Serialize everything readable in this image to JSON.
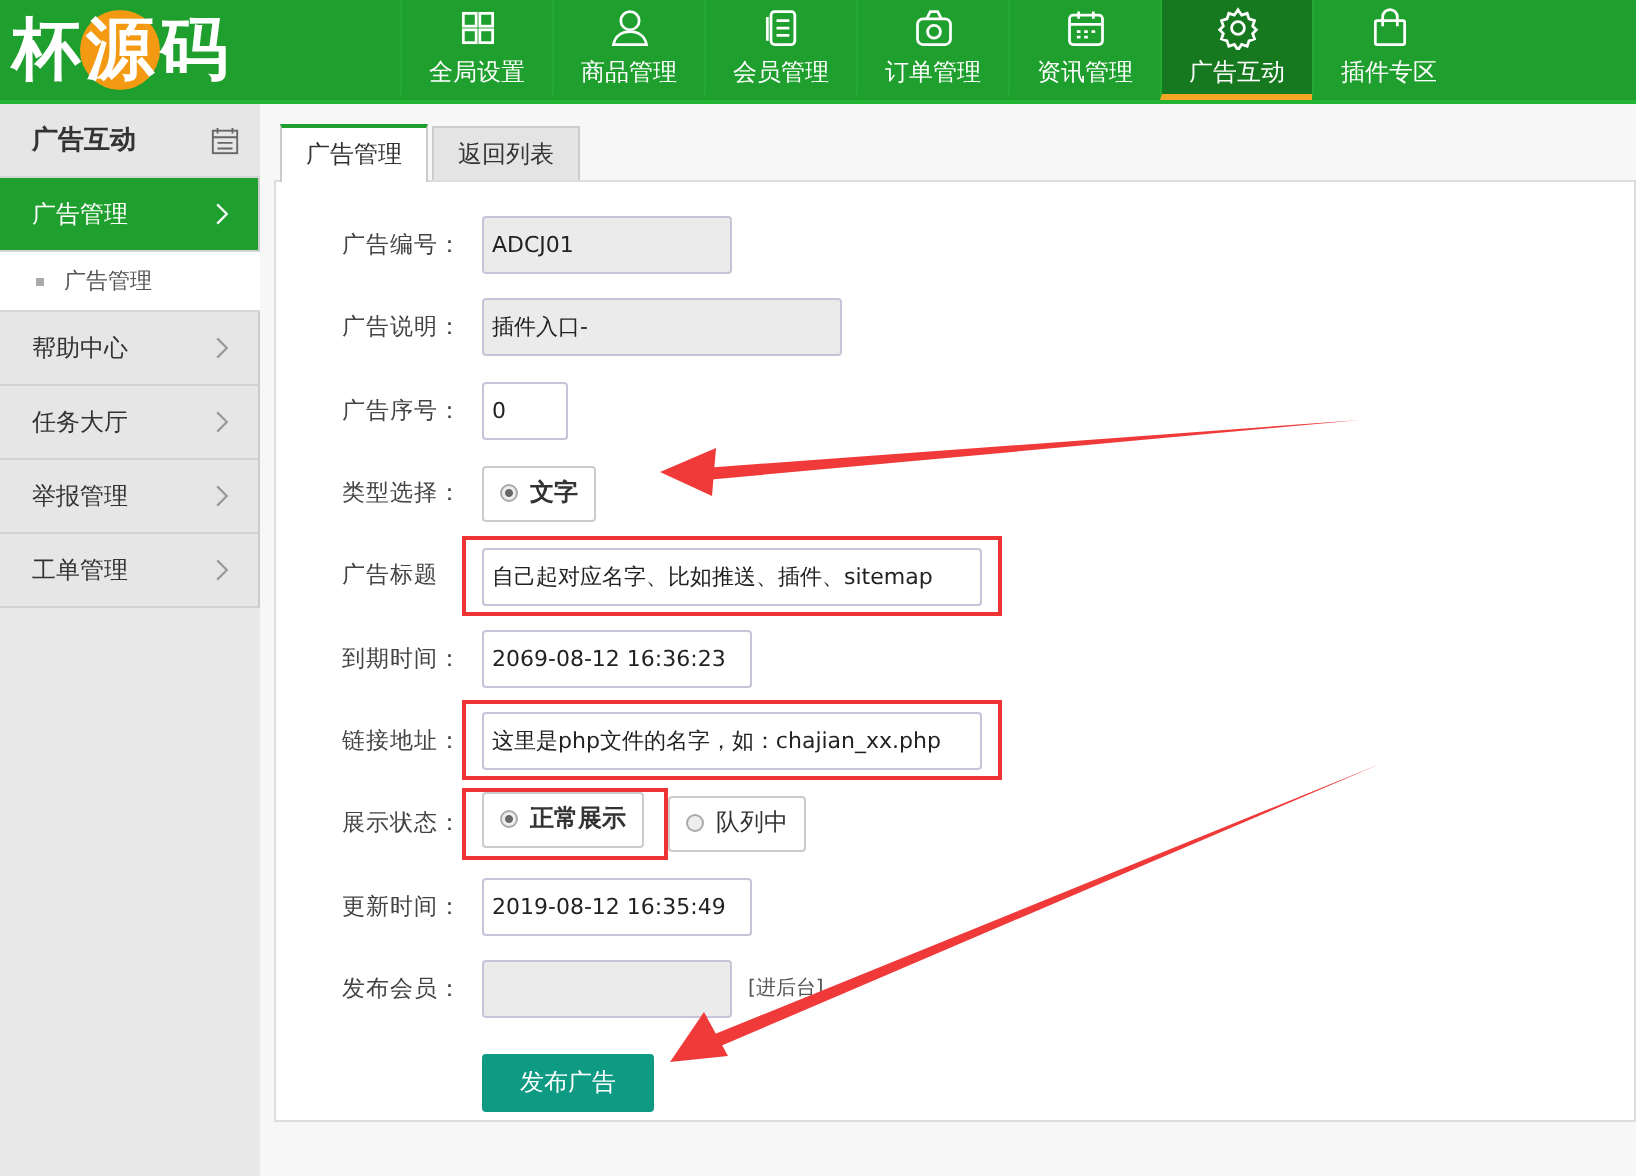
{
  "logo": {
    "parts": [
      "杯",
      "源",
      "码"
    ]
  },
  "nav": [
    {
      "label": "全局设置",
      "selected": false
    },
    {
      "label": "商品管理",
      "selected": false
    },
    {
      "label": "会员管理",
      "selected": false
    },
    {
      "label": "订单管理",
      "selected": false
    },
    {
      "label": "资讯管理",
      "selected": false
    },
    {
      "label": "广告互动",
      "selected": true
    },
    {
      "label": "插件专区",
      "selected": false
    }
  ],
  "sidebar": {
    "title": "广告互动",
    "items": [
      {
        "label": "广告管理",
        "selected": true,
        "children": [
          {
            "label": "广告管理"
          }
        ]
      },
      {
        "label": "帮助中心",
        "selected": false
      },
      {
        "label": "任务大厅",
        "selected": false
      },
      {
        "label": "举报管理",
        "selected": false
      },
      {
        "label": "工单管理",
        "selected": false
      }
    ]
  },
  "tabs": [
    {
      "label": "广告管理",
      "selected": true
    },
    {
      "label": "返回列表",
      "selected": false
    }
  ],
  "form": {
    "fields": [
      {
        "kind": "input",
        "label": "广告编号：",
        "value": "ADCJ01",
        "disabled": true,
        "highlighted": false
      },
      {
        "kind": "input",
        "label": "广告说明：",
        "value": "插件入口-",
        "disabled": true,
        "highlighted": false
      },
      {
        "kind": "input",
        "label": "广告序号：",
        "value": "0",
        "disabled": false,
        "highlighted": false
      },
      {
        "kind": "radio",
        "label": "类型选择：",
        "options": [
          {
            "label": "文字",
            "selected": true,
            "highlighted": false
          }
        ]
      },
      {
        "kind": "input",
        "label": "广告标题",
        "value": "自己起对应名字、比如推送、插件、sitemap",
        "disabled": false,
        "highlighted": true
      },
      {
        "kind": "input",
        "label": "到期时间：",
        "value": "2069-08-12 16:36:23",
        "disabled": false,
        "highlighted": false
      },
      {
        "kind": "input",
        "label": "链接地址：",
        "value": "这里是php文件的名字，如：chajian_xx.php",
        "disabled": false,
        "highlighted": true
      },
      {
        "kind": "radio",
        "label": "展示状态：",
        "options": [
          {
            "label": "正常展示",
            "selected": true,
            "highlighted": true
          },
          {
            "label": "队列中",
            "selected": false,
            "highlighted": false
          }
        ]
      },
      {
        "kind": "input",
        "label": "更新时间：",
        "value": "2019-08-12 16:35:49",
        "disabled": false,
        "highlighted": false
      },
      {
        "kind": "input",
        "label": "发布会员：",
        "disabled": true,
        "highlighted": false,
        "note": "[进后台]"
      }
    ],
    "submit": "发布广告"
  }
}
